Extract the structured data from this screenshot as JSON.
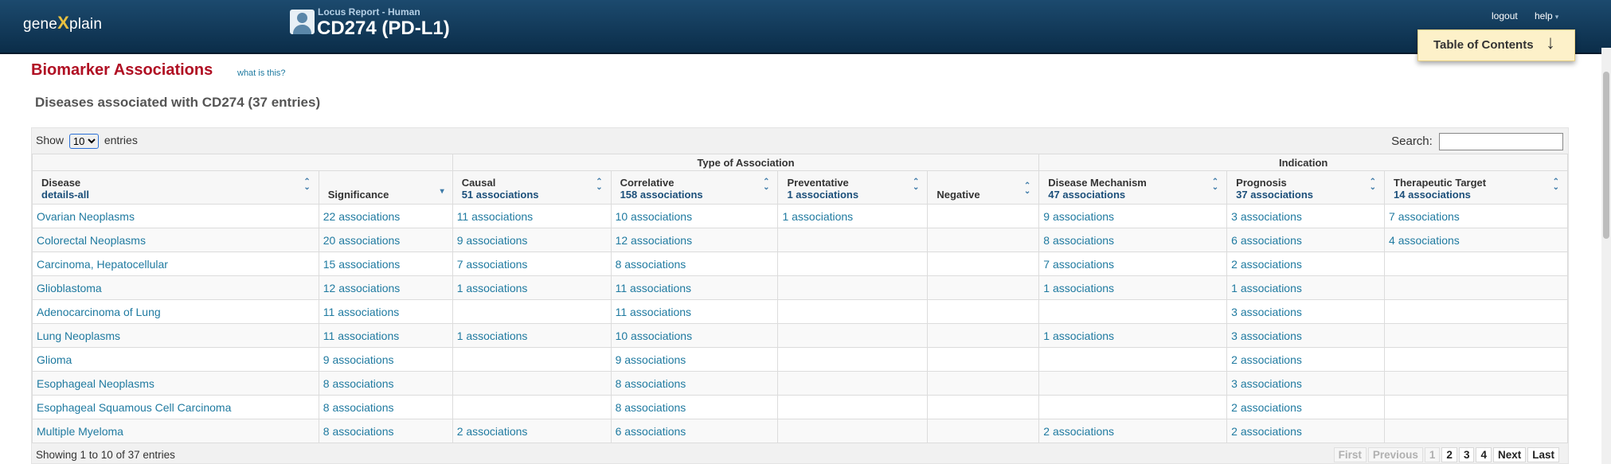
{
  "header": {
    "logo": {
      "part1": "gene",
      "part2": "X",
      "part3": "plain"
    },
    "report_type": "Locus Report - Human",
    "title": "CD274 (PD-L1)",
    "logout": "logout",
    "help": "help",
    "toc": "Table of Contents"
  },
  "page": {
    "title": "Biomarker Associations",
    "what_link": "what is this?",
    "section_title": "Diseases associated with CD274 (37 entries)"
  },
  "controls": {
    "show_label": "Show",
    "entries_label": "entries",
    "page_size": "10",
    "search_label": "Search:"
  },
  "table": {
    "groups": {
      "type": "Type of Association",
      "indication": "Indication"
    },
    "columns": [
      {
        "label": "Disease",
        "sub": "details-all"
      },
      {
        "label": "Significance",
        "sub": ""
      },
      {
        "label": "Causal",
        "sub": "51 associations"
      },
      {
        "label": "Correlative",
        "sub": "158 associations"
      },
      {
        "label": "Preventative",
        "sub": "1 associations"
      },
      {
        "label": "Negative",
        "sub": ""
      },
      {
        "label": "Disease Mechanism",
        "sub": "47 associations"
      },
      {
        "label": "Prognosis",
        "sub": "37 associations"
      },
      {
        "label": "Therapeutic Target",
        "sub": "14 associations"
      }
    ],
    "rows": [
      [
        "Ovarian Neoplasms",
        "22 associations",
        "11 associations",
        "10 associations",
        "1 associations",
        "",
        "9 associations",
        "3 associations",
        "7 associations"
      ],
      [
        "Colorectal Neoplasms",
        "20 associations",
        "9 associations",
        "12 associations",
        "",
        "",
        "8 associations",
        "6 associations",
        "4 associations"
      ],
      [
        "Carcinoma, Hepatocellular",
        "15 associations",
        "7 associations",
        "8 associations",
        "",
        "",
        "7 associations",
        "2 associations",
        ""
      ],
      [
        "Glioblastoma",
        "12 associations",
        "1 associations",
        "11 associations",
        "",
        "",
        "1 associations",
        "1 associations",
        ""
      ],
      [
        "Adenocarcinoma of Lung",
        "11 associations",
        "",
        "11 associations",
        "",
        "",
        "",
        "3 associations",
        ""
      ],
      [
        "Lung Neoplasms",
        "11 associations",
        "1 associations",
        "10 associations",
        "",
        "",
        "1 associations",
        "3 associations",
        ""
      ],
      [
        "Glioma",
        "9 associations",
        "",
        "9 associations",
        "",
        "",
        "",
        "2 associations",
        ""
      ],
      [
        "Esophageal Neoplasms",
        "8 associations",
        "",
        "8 associations",
        "",
        "",
        "",
        "3 associations",
        ""
      ],
      [
        "Esophageal Squamous Cell Carcinoma",
        "8 associations",
        "",
        "8 associations",
        "",
        "",
        "",
        "2 associations",
        ""
      ],
      [
        "Multiple Myeloma",
        "8 associations",
        "2 associations",
        "6 associations",
        "",
        "",
        "2 associations",
        "2 associations",
        ""
      ]
    ]
  },
  "footer": {
    "info": "Showing 1 to 10 of 37 entries",
    "pager": {
      "first": "First",
      "previous": "Previous",
      "pages": [
        "1",
        "2",
        "3",
        "4"
      ],
      "next": "Next",
      "last": "Last"
    }
  }
}
